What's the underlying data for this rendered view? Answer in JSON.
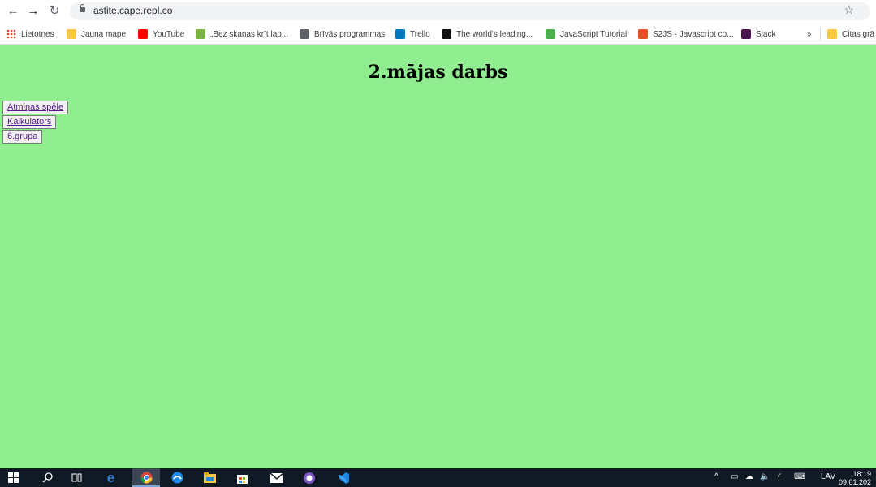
{
  "browser": {
    "url": "astite.cape.repl.co",
    "bookmarks": [
      {
        "label": "Lietotnes",
        "icon": "apps-grid-icon"
      },
      {
        "label": "Jauna mape",
        "icon": "folder-icon"
      },
      {
        "label": "YouTube",
        "icon": "youtube-icon"
      },
      {
        "label": "„Bez skaņas krīt lap...",
        "icon": "leaf-icon"
      },
      {
        "label": "Brīvās programmas",
        "icon": "globe-icon"
      },
      {
        "label": "Trello",
        "icon": "trello-icon"
      },
      {
        "label": "The world's leading...",
        "icon": "github-icon"
      },
      {
        "label": "JavaScript Tutorial",
        "icon": "javascript-tutorial-icon"
      },
      {
        "label": "S2JS - Javascript co...",
        "icon": "s2js-icon"
      },
      {
        "label": "Slack",
        "icon": "slack-icon"
      },
      {
        "label": "»",
        "icon": ""
      },
      {
        "label": "Citas grā",
        "icon": "folder-icon"
      }
    ]
  },
  "page": {
    "title": "2.mājas darbs",
    "buttons": [
      "Atmiņas spēle",
      "Kalkulators",
      "6.grupa"
    ],
    "background_color": "#90ee90"
  },
  "taskbar": {
    "language": "LAV",
    "time": "18:19",
    "date": "09.01.202"
  }
}
